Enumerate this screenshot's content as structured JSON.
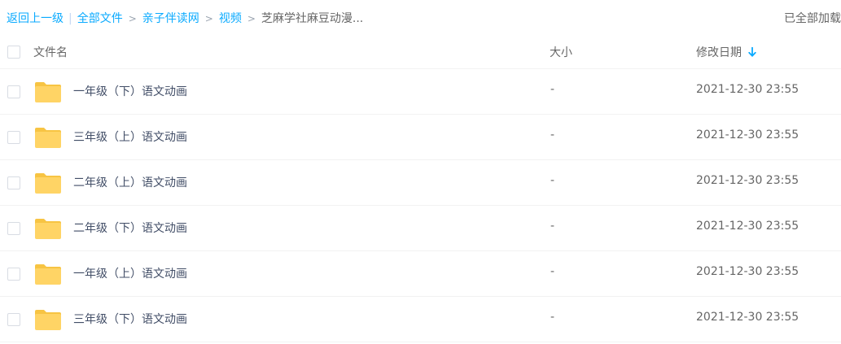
{
  "breadcrumb": {
    "back": "返回上一级",
    "separator": "|",
    "items": [
      "全部文件",
      "亲子伴读网",
      "视频"
    ],
    "arrow": ">",
    "current": "芝麻学社麻豆动漫..."
  },
  "status": {
    "loaded": "已全部加载"
  },
  "table": {
    "headers": {
      "name": "文件名",
      "size": "大小",
      "date": "修改日期"
    },
    "sort_icon": "arrow-down-icon",
    "rows": [
      {
        "icon": "folder-icon",
        "name": "一年级（下）语文动画",
        "size": "-",
        "date": "2021-12-30 23:55"
      },
      {
        "icon": "folder-icon",
        "name": "三年级（上）语文动画",
        "size": "-",
        "date": "2021-12-30 23:55"
      },
      {
        "icon": "folder-icon",
        "name": "二年级（上）语文动画",
        "size": "-",
        "date": "2021-12-30 23:55"
      },
      {
        "icon": "folder-icon",
        "name": "二年级（下）语文动画",
        "size": "-",
        "date": "2021-12-30 23:55"
      },
      {
        "icon": "folder-icon",
        "name": "一年级（上）语文动画",
        "size": "-",
        "date": "2021-12-30 23:55"
      },
      {
        "icon": "folder-icon",
        "name": "三年级（下）语文动画",
        "size": "-",
        "date": "2021-12-30 23:55"
      }
    ]
  },
  "colors": {
    "link": "#09aaff",
    "folder": "#ffd465",
    "folder_tab": "#f7c443",
    "row_border": "#f2f2f2"
  }
}
